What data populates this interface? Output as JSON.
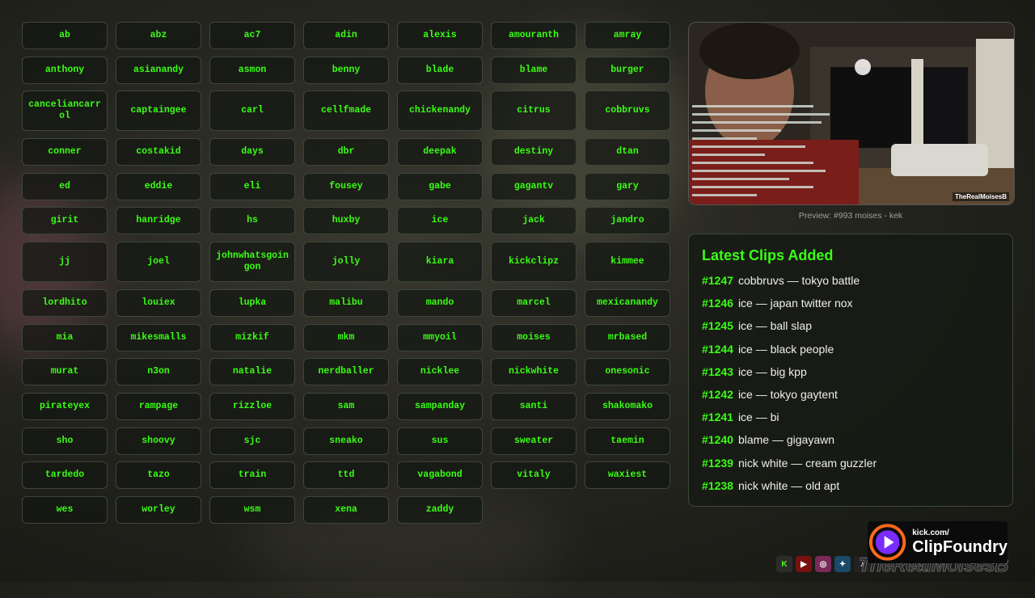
{
  "buttons": [
    {
      "label": "ab"
    },
    {
      "label": "abz"
    },
    {
      "label": "ac7"
    },
    {
      "label": "adin"
    },
    {
      "label": "alexis"
    },
    {
      "label": "amouranth"
    },
    {
      "label": "amray"
    },
    {
      "label": "anthony"
    },
    {
      "label": "asianandy"
    },
    {
      "label": "asmon"
    },
    {
      "label": "benny"
    },
    {
      "label": "blade"
    },
    {
      "label": "blame"
    },
    {
      "label": "burger"
    },
    {
      "label": "canceliancarrol"
    },
    {
      "label": "captaingee"
    },
    {
      "label": "carl"
    },
    {
      "label": "cellfmade"
    },
    {
      "label": "chickenandy"
    },
    {
      "label": "citrus"
    },
    {
      "label": "cobbruvs"
    },
    {
      "label": "conner"
    },
    {
      "label": "costakid"
    },
    {
      "label": "days"
    },
    {
      "label": "dbr"
    },
    {
      "label": "deepak"
    },
    {
      "label": "destiny"
    },
    {
      "label": "dtan"
    },
    {
      "label": "ed"
    },
    {
      "label": "eddie"
    },
    {
      "label": "eli"
    },
    {
      "label": "fousey"
    },
    {
      "label": "gabe"
    },
    {
      "label": "gagantv"
    },
    {
      "label": "gary"
    },
    {
      "label": "girit"
    },
    {
      "label": "hanridge"
    },
    {
      "label": "hs"
    },
    {
      "label": "huxby"
    },
    {
      "label": "ice"
    },
    {
      "label": "jack"
    },
    {
      "label": "jandro"
    },
    {
      "label": "jj"
    },
    {
      "label": "joel"
    },
    {
      "label": "johnwhatsgoingon"
    },
    {
      "label": "jolly"
    },
    {
      "label": "kiara"
    },
    {
      "label": "kickclipz"
    },
    {
      "label": "kimmee"
    },
    {
      "label": "lordhito"
    },
    {
      "label": "louiex"
    },
    {
      "label": "lupka"
    },
    {
      "label": "malibu"
    },
    {
      "label": "mando"
    },
    {
      "label": "marcel"
    },
    {
      "label": "mexicanandy"
    },
    {
      "label": "mia"
    },
    {
      "label": "mikesmalls"
    },
    {
      "label": "mizkif"
    },
    {
      "label": "mkm"
    },
    {
      "label": "mmyoil"
    },
    {
      "label": "moises"
    },
    {
      "label": "mrbased"
    },
    {
      "label": "murat"
    },
    {
      "label": "n3on"
    },
    {
      "label": "natalie"
    },
    {
      "label": "nerdballer"
    },
    {
      "label": "nicklee"
    },
    {
      "label": "nickwhite"
    },
    {
      "label": "onesonic"
    },
    {
      "label": "pirateyex"
    },
    {
      "label": "rampage"
    },
    {
      "label": "rizzloe"
    },
    {
      "label": "sam"
    },
    {
      "label": "sampanday"
    },
    {
      "label": "santi"
    },
    {
      "label": "shakomako"
    },
    {
      "label": "sho"
    },
    {
      "label": "shoovy"
    },
    {
      "label": "sjc"
    },
    {
      "label": "sneako"
    },
    {
      "label": "sus"
    },
    {
      "label": "sweater"
    },
    {
      "label": "taemin"
    },
    {
      "label": "tardedo"
    },
    {
      "label": "tazo"
    },
    {
      "label": "train"
    },
    {
      "label": "ttd"
    },
    {
      "label": "vagabond"
    },
    {
      "label": "vitaly"
    },
    {
      "label": "waxiest"
    },
    {
      "label": "wes"
    },
    {
      "label": "worley"
    },
    {
      "label": "wsm"
    },
    {
      "label": "xena"
    },
    {
      "label": "zaddy"
    }
  ],
  "preview": {
    "caption": "Preview: #993 moises - kek",
    "overlay_handle": "TheRealMoisesB"
  },
  "clips": {
    "title": "Latest Clips Added",
    "items": [
      {
        "num": "#1247",
        "text": "cobbruvs — tokyo battle"
      },
      {
        "num": "#1246",
        "text": "ice — japan twitter nox"
      },
      {
        "num": "#1245",
        "text": "ice — ball slap"
      },
      {
        "num": "#1244",
        "text": "ice — black people"
      },
      {
        "num": "#1243",
        "text": "ice — big kpp"
      },
      {
        "num": "#1242",
        "text": "ice — tokyo gaytent"
      },
      {
        "num": "#1241",
        "text": "ice — bi"
      },
      {
        "num": "#1240",
        "text": "blame — gigayawn"
      },
      {
        "num": "#1239",
        "text": "nick white — cream guzzler"
      },
      {
        "num": "#1238",
        "text": "nick white — old apt"
      }
    ]
  },
  "branding": {
    "logo_small": "kick.com/",
    "logo_big": "ClipFoundry",
    "watermark_handle": "TheRealMoisesB",
    "social_icons": [
      "kick-icon",
      "youtube-icon",
      "instagram-icon",
      "twitter-icon",
      "tiktok-icon"
    ]
  },
  "colors": {
    "accent": "#39ff14",
    "panel": "#16181a"
  }
}
